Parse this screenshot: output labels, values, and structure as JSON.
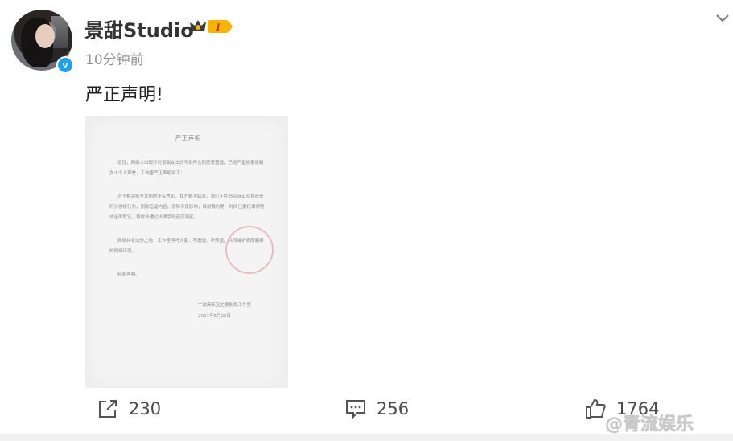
{
  "post": {
    "username": "景甜Studio",
    "badge_level": "I",
    "time": "10分钟前",
    "text": "严正声明!"
  },
  "document": {
    "title": "严正声明",
    "paragraphs": [
      "近日，网络上出现针对景甜女士的不实传言和恶意造谣，已经严重损害景甜女士个人声誉，工作室严正声明如下：",
      "对于相关账号发布的不实言论，我方绝不姑息，我们正在追究诉讼及将追责所涉侵权行为，删除造谣内容，消除不良影响，目前我方第一时间已委托律师完成全面取证，将依法通过法律手段追究到底。",
      "网络并非法外之地，工作室呼吁大家：不造谣、不传谣，共同维护清朗健康的网络环境。",
      "特此声明。"
    ],
    "signature": "宁波高新区之景影视工作室",
    "date": "2021年5月22日"
  },
  "actions": {
    "repost_count": "230",
    "comment_count": "256",
    "like_count": "1764"
  },
  "watermark": "@青流娱乐",
  "colors": {
    "accent_blue": "#1da1f2",
    "muted": "#939393",
    "badge_gold": "#f6b500"
  }
}
